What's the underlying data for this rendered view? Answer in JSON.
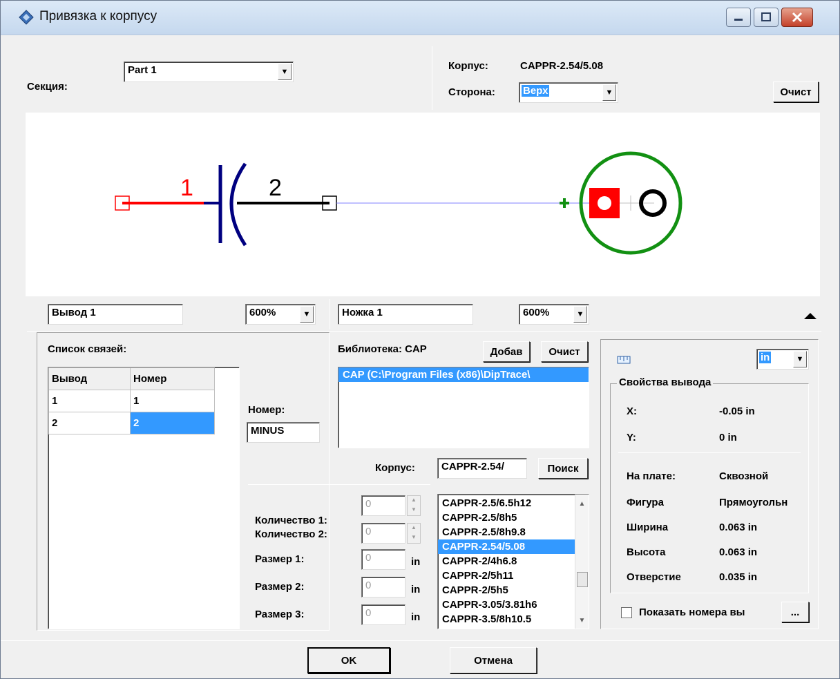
{
  "window": {
    "title": "Привязка к корпусу"
  },
  "section": {
    "label": "Секция:",
    "value": "Part 1"
  },
  "package": {
    "label": "Корпус:",
    "value": "CAPPR-2.54/5.08"
  },
  "side": {
    "label": "Сторона:",
    "value": "Верх",
    "clear_button": "Очист"
  },
  "canvas": {
    "pin1": "1",
    "pin2": "2"
  },
  "left_view": {
    "pin_name": "Вывод 1",
    "zoom": "600%"
  },
  "right_view": {
    "pad_name": "Ножка 1",
    "zoom": "600%"
  },
  "links": {
    "label": "Список связей:",
    "columns": [
      "Вывод",
      "Номер"
    ],
    "rows": [
      [
        "1",
        "1"
      ],
      [
        "2",
        "2"
      ]
    ],
    "number_label": "Номер:",
    "number_value": "MINUS"
  },
  "library": {
    "label": "Библиотека: CAP",
    "add_button": "Добав",
    "clear_button": "Очист",
    "items": [
      "CAP (C:\\Program Files (x86)\\DipTrace\\"
    ]
  },
  "package_search": {
    "label": "Корпус:",
    "value": "CAPPR-2.54/",
    "search_button": "Поиск",
    "list": [
      "CAPPR-2.5/6.5h12",
      "CAPPR-2.5/8h5",
      "CAPPR-2.5/8h9.8",
      "CAPPR-2.54/5.08",
      "CAPPR-2/4h6.8",
      "CAPPR-2/5h11",
      "CAPPR-2/5h5",
      "CAPPR-3.05/3.81h6",
      "CAPPR-3.5/8h10.5"
    ],
    "selected_index": 3
  },
  "params": {
    "qty1_label": "Количество 1:",
    "qty1": "0",
    "qty2_label": "Количество 2:",
    "qty2": "0",
    "size1_label": "Размер 1:",
    "size1": "0",
    "size2_label": "Размер 2:",
    "size2": "0",
    "size3_label": "Размер 3:",
    "size3": "0",
    "unit": "in"
  },
  "props": {
    "unit": "in",
    "group_label": "Свойства вывода",
    "x_label": "X:",
    "x": "-0.05 in",
    "y_label": "Y:",
    "y": "0 in",
    "on_board_label": "На плате:",
    "on_board": "Сквозной",
    "shape_label": "Фигура",
    "shape": "Прямоугольн",
    "width_label": "Ширина",
    "width": "0.063 in",
    "height_label": "Высота",
    "height": "0.063 in",
    "hole_label": "Отверстие",
    "hole": "0.035 in",
    "show_numbers": "Показать номера вы",
    "more_button": "..."
  },
  "buttons": {
    "ok": "OK",
    "cancel": "Отмена"
  },
  "colors": {
    "selection": "#3399ff",
    "pin1": "#ff0000",
    "body": "#000080",
    "pad_outline": "#008000"
  }
}
